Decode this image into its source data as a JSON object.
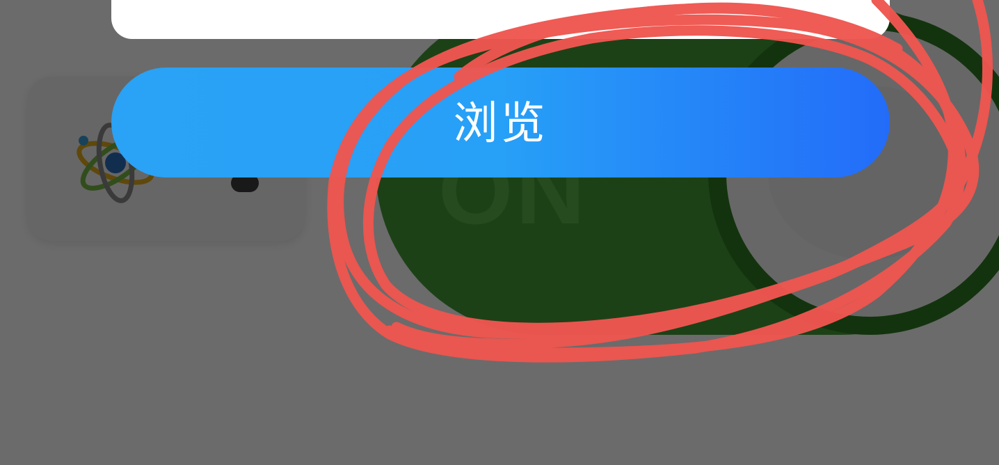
{
  "dialog": {
    "browse_label": "浏览"
  },
  "background_app": {
    "toggle_text": "ON",
    "toggle_color": "#469c37",
    "card_icon": "atom-icon"
  },
  "overlay": {
    "dim_color": "#000000"
  },
  "annotation": {
    "type": "freehand-circle",
    "color": "#ef5650"
  },
  "colors": {
    "button_gradient_start": "#2aa2f5",
    "button_gradient_end": "#236cf9",
    "dialog_background": "#ffffff"
  }
}
